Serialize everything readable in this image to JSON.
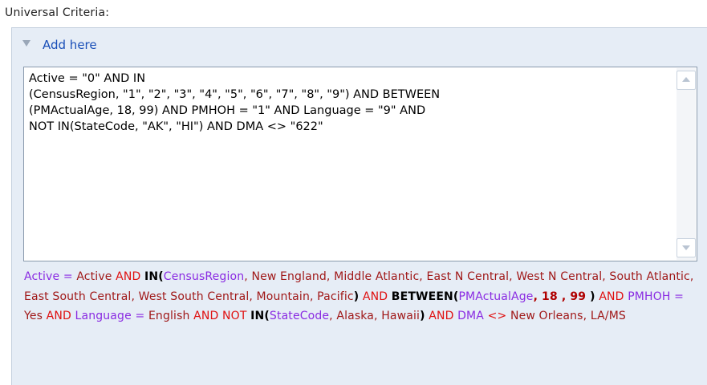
{
  "heading": "Universal Criteria:",
  "add_link": "Add here",
  "criteria_text": "Active = \"0\" AND IN\n(CensusRegion, \"1\", \"2\", \"3\", \"4\", \"5\", \"6\", \"7\", \"8\", \"9\") AND BETWEEN\n(PMActualAge, 18, 99) AND PMHOH = \"1\" AND Language = \"9\" AND\nNOT IN(StateCode, \"AK\", \"HI\") AND DMA <> \"622\"",
  "description": {
    "t01": "Active",
    "t02": " = ",
    "t03": "Active",
    "t04": " AND ",
    "t05": "IN(",
    "t06": "CensusRegion",
    "t07": ", New England, Middle Atlantic, East N Central, West N Central, South Atlantic, East South Central, West South Central, Mountain, Pacific",
    "t08": ")",
    "t09": " AND ",
    "t10": "BETWEEN(",
    "t11": "PMActualAge",
    "t12": ", 18 , 99 ",
    "t13": ")",
    "t14": " AND ",
    "t15": "PMHOH",
    "t16": " = ",
    "t17": "Yes",
    "t18": " AND ",
    "t19": "Language",
    "t20": " = ",
    "t21": "English",
    "t22": " AND NOT ",
    "t23": "IN(",
    "t24": "StateCode",
    "t25": ", Alaska, Hawaii",
    "t26": ")",
    "t27": " AND ",
    "t28": "DMA",
    "t29": " <> ",
    "t30": "New Orleans, LA/MS"
  },
  "colors": {
    "field": "#8a2be2",
    "operator": "#e01010",
    "keyword": "#000000",
    "value": "#a01818",
    "link": "#1a4fb8",
    "panel_bg": "#e6edf6"
  },
  "icons": {
    "collapse": "triangle-down-icon",
    "scroll_up": "scroll-up-arrow-icon",
    "scroll_down": "scroll-down-arrow-icon"
  }
}
